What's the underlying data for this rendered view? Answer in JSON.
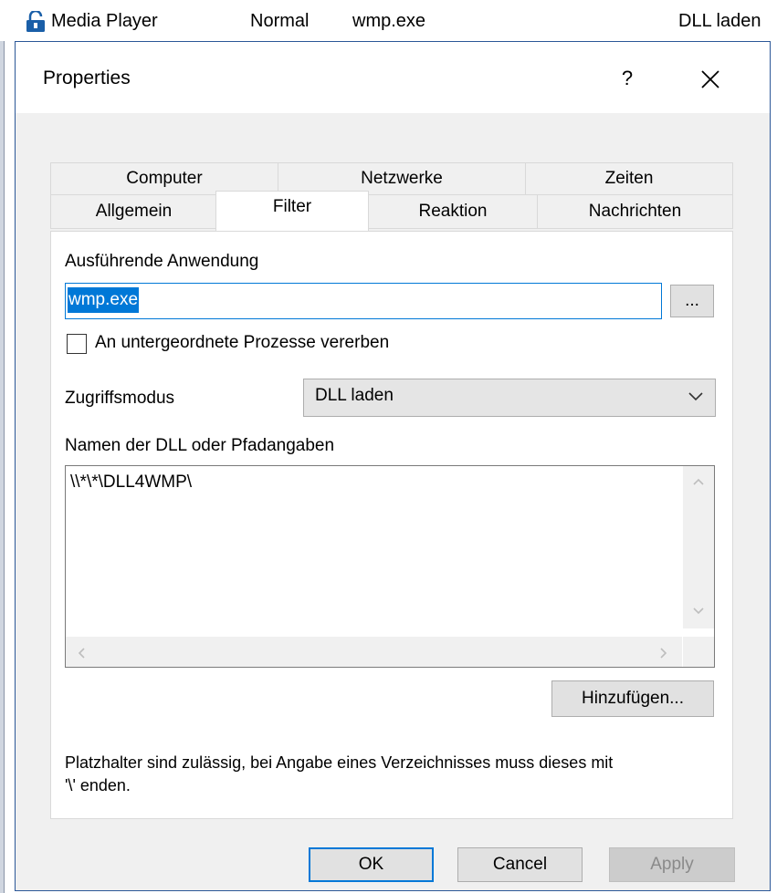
{
  "list_row": {
    "app_name": "Media Player",
    "mode": "Normal",
    "exe": "wmp.exe",
    "access": "DLL laden",
    "icon": "lock-icon"
  },
  "dialog": {
    "title": "Properties",
    "help_label": "?",
    "close_icon": "close-icon"
  },
  "tabs": {
    "row1": [
      "Computer",
      "Netzwerke",
      "Zeiten"
    ],
    "row2": [
      "Allgemein",
      "Filter",
      "Reaktion",
      "Nachrichten"
    ],
    "active": "Filter"
  },
  "filter": {
    "app_label": "Ausführende Anwendung",
    "app_value": "wmp.exe",
    "browse_label": "...",
    "inherit_label": "An untergeordnete Prozesse vererben",
    "inherit_checked": false,
    "mode_label": "Zugriffsmodus",
    "mode_value": "DLL laden",
    "dll_label": "Namen der DLL oder Pfadangaben",
    "dll_entries": [
      "\\\\*\\*\\DLL4WMP\\"
    ],
    "add_label": "Hinzufügen...",
    "hint_line1": "Platzhalter sind zulässig, bei Angabe eines Verzeichnisses muss dieses mit",
    "hint_line2": "'\\' enden."
  },
  "buttons": {
    "ok": "OK",
    "cancel": "Cancel",
    "apply": "Apply"
  },
  "colors": {
    "accent": "#0078d7",
    "dialog_border": "#2b5797",
    "body_bg": "#f0f0f0"
  }
}
